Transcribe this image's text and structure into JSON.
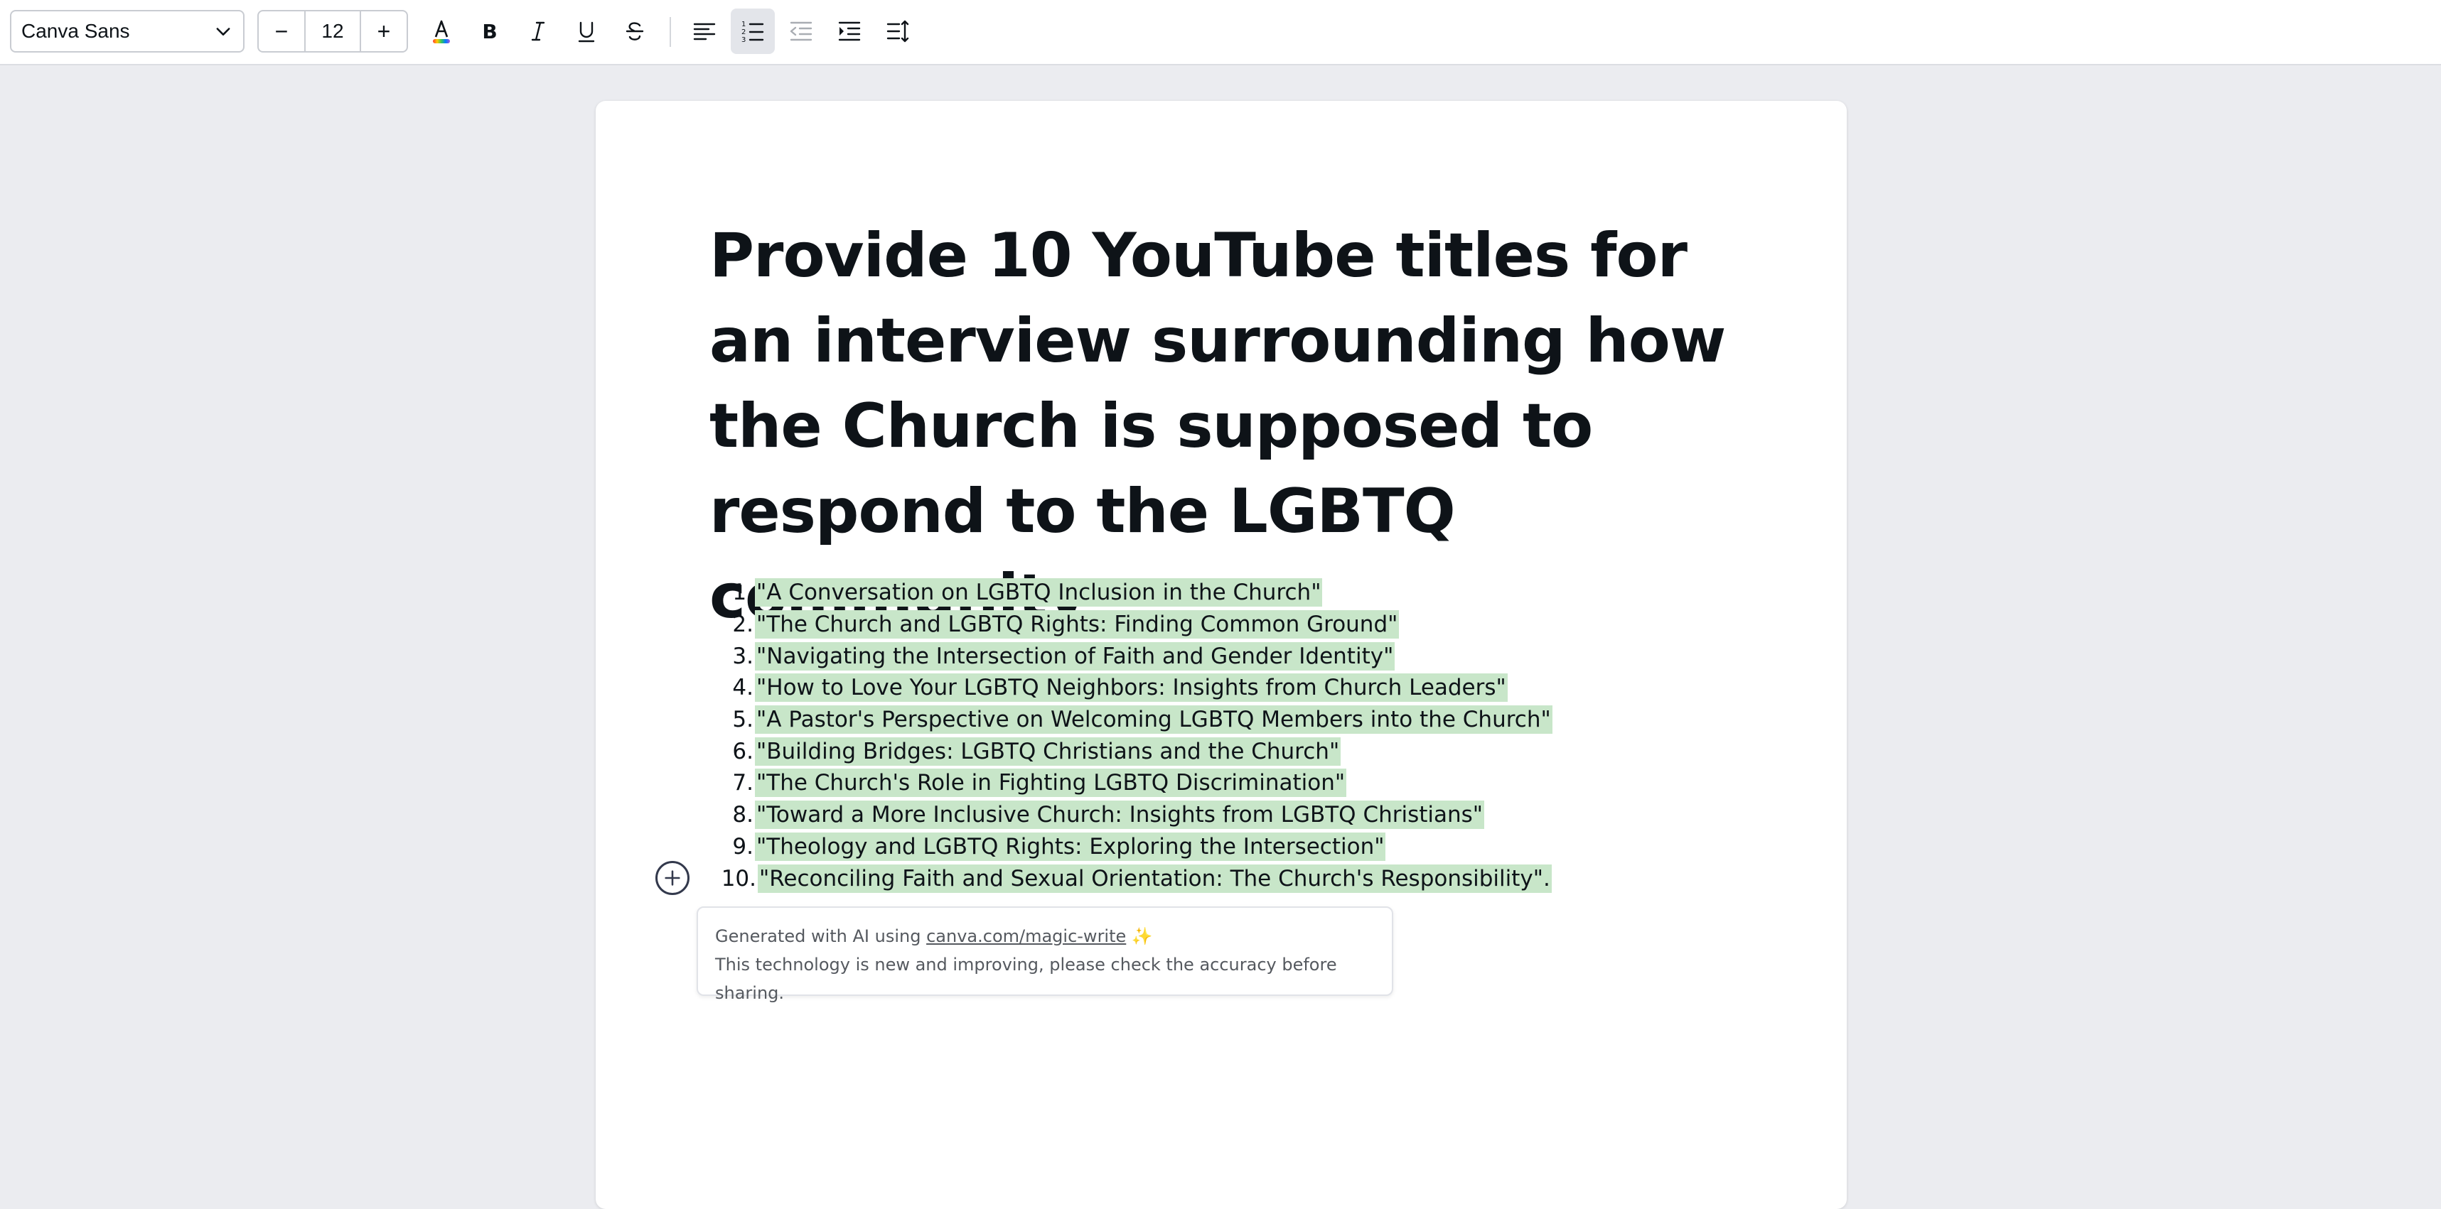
{
  "toolbar": {
    "font_name": "Canva Sans",
    "font_size": "12",
    "decrease_label": "−",
    "increase_label": "+",
    "tools": [
      {
        "name": "text-color",
        "active": false
      },
      {
        "name": "bold",
        "active": false
      },
      {
        "name": "italic",
        "active": false
      },
      {
        "name": "underline",
        "active": false
      },
      {
        "name": "strikethrough",
        "active": false
      },
      {
        "name": "align-left",
        "active": false
      },
      {
        "name": "numbered-list",
        "active": true
      },
      {
        "name": "outdent",
        "active": false
      },
      {
        "name": "indent",
        "active": false
      },
      {
        "name": "line-spacing",
        "active": false
      }
    ]
  },
  "document": {
    "title": "Provide 10 YouTube titles for an interview surrounding how the Church is supposed to respond to the LGBTQ community",
    "items": [
      {
        "num": "1.",
        "text": "\"A Conversation on LGBTQ Inclusion in the Church\""
      },
      {
        "num": "2.",
        "text": "\"The Church and LGBTQ Rights: Finding Common Ground\""
      },
      {
        "num": "3.",
        "text": "\"Navigating the Intersection of Faith and Gender Identity\""
      },
      {
        "num": "4.",
        "text": "\"How to Love Your LGBTQ Neighbors: Insights from Church Leaders\""
      },
      {
        "num": "5.",
        "text": "\"A Pastor's Perspective on Welcoming LGBTQ Members into the Church\""
      },
      {
        "num": "6.",
        "text": "\"Building Bridges: LGBTQ Christians and the Church\""
      },
      {
        "num": "7.",
        "text": "\"The Church's Role in Fighting LGBTQ Discrimination\""
      },
      {
        "num": "8.",
        "text": "\"Toward a More Inclusive Church: Insights from LGBTQ Christians\""
      },
      {
        "num": "9.",
        "text": "\"Theology and LGBTQ Rights: Exploring the Intersection\""
      },
      {
        "num": "10.",
        "text": "\"Reconciling Faith and Sexual Orientation: The Church's Responsibility\"."
      }
    ]
  },
  "ai_note": {
    "line1_prefix": "Generated with AI using ",
    "link": "canva.com/magic-write",
    "sparkle": "✨",
    "line2": "This technology is new and improving, please check the accuracy before sharing."
  },
  "colors": {
    "highlight": "#c8e6c9",
    "background": "#ebecf0",
    "text": "#0e1318"
  }
}
